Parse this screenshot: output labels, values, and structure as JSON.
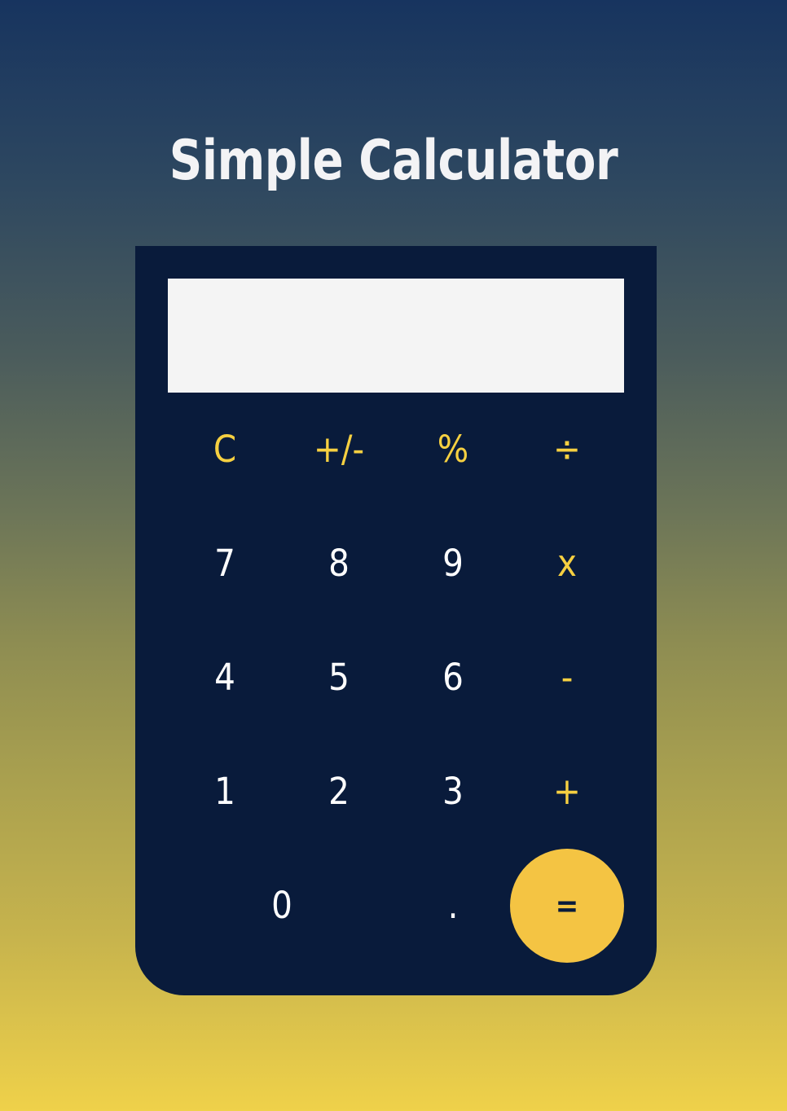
{
  "title": "Simple Calculator",
  "display": {
    "value": ""
  },
  "keys": {
    "clear": "C",
    "sign": "+/-",
    "percent": "%",
    "divide": "÷",
    "seven": "7",
    "eight": "8",
    "nine": "9",
    "multiply": "x",
    "four": "4",
    "five": "5",
    "six": "6",
    "subtract": "-",
    "one": "1",
    "two": "2",
    "three": "3",
    "add": "+",
    "zero": "0",
    "decimal": ".",
    "equals": "="
  },
  "colors": {
    "calculator_body": "#091b3b",
    "display": "#f4f4f4",
    "operator_text": "#f6d041",
    "equals_button": "#f4c443",
    "digit_text": "#ffffff",
    "title_text": "#f3f3f5"
  }
}
